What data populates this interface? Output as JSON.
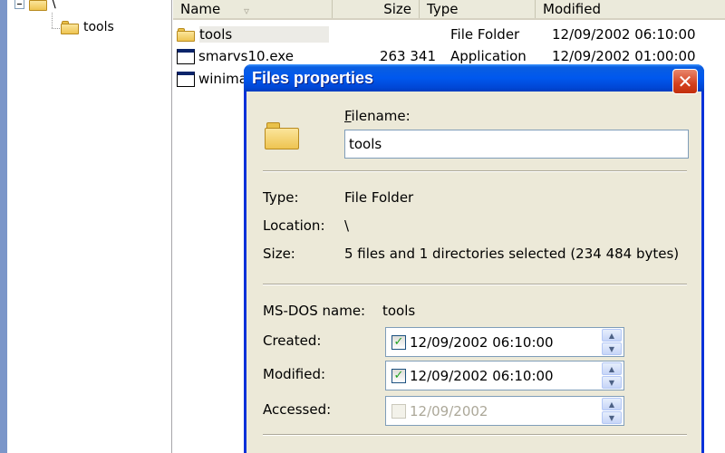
{
  "tree": {
    "root_label": "\\",
    "child_label": "tools"
  },
  "list": {
    "columns": {
      "name": "Name",
      "size": "Size",
      "type": "Type",
      "modified": "Modified"
    },
    "rows": [
      {
        "name": "tools",
        "size": "",
        "type": "File Folder",
        "modified": "12/09/2002  06:10:00",
        "icon": "folder-icon"
      },
      {
        "name": "smarvs10.exe",
        "size": "263 341",
        "type": "Application",
        "modified": "12/09/2002  01:00:00",
        "icon": "application-icon"
      },
      {
        "name": "winima",
        "size": "",
        "type": "",
        "modified": "",
        "icon": "application-icon"
      }
    ]
  },
  "dialog": {
    "title": "Files properties",
    "close_glyph": "✕",
    "filename_label": "Filename:",
    "filename_value": "tools",
    "type_label": "Type:",
    "type_value": "File Folder",
    "location_label": "Location:",
    "location_value": "\\",
    "size_label": "Size:",
    "size_value": "5 files and 1 directories selected (234 484 bytes)",
    "msdos_label": "MS-DOS name:",
    "msdos_value": "tools",
    "created_label": "Created:",
    "created_value": "12/09/2002 06:10:00",
    "created_checked": true,
    "modified_label": "Modified:",
    "modified_value": "12/09/2002 06:10:00",
    "modified_checked": true,
    "accessed_label": "Accessed:",
    "accessed_value": "12/09/2002",
    "accessed_checked": false,
    "check_glyph": "✓",
    "spin_up_glyph": "▲",
    "spin_down_glyph": "▼"
  },
  "colors": {
    "titlebar": "#0058ee",
    "dialog_bg": "#ece9d8",
    "close_button": "#d4401e",
    "check": "#21a121"
  }
}
